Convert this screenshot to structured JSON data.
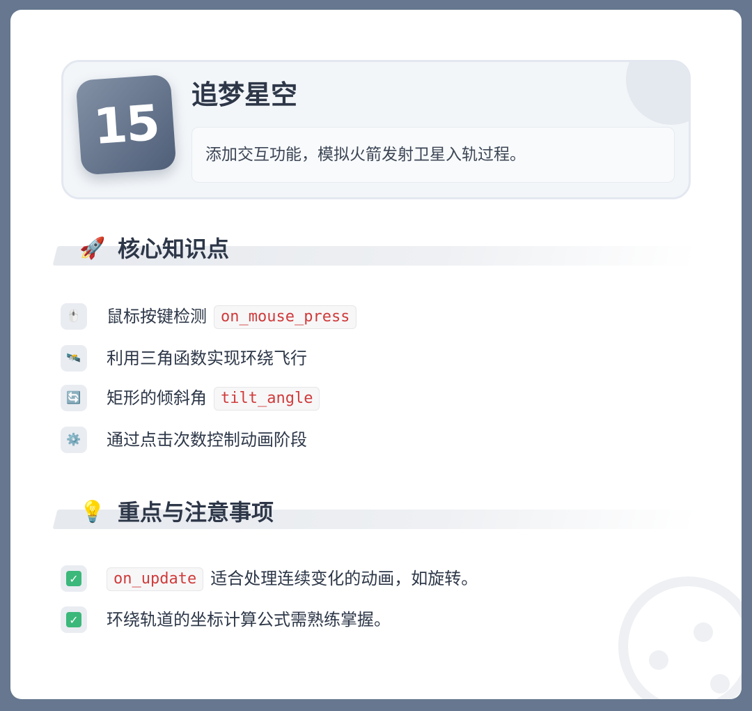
{
  "lesson": {
    "number": "15",
    "title": "追梦星空",
    "description": "添加交互功能，模拟火箭发射卫星入轨过程。"
  },
  "sections": [
    {
      "icon": "rocket-icon",
      "icon_glyph": "🚀",
      "title": "核心知识点",
      "items": [
        {
          "icon": "mouse-icon",
          "icon_glyph": "🖱️",
          "text": "鼠标按键检测",
          "code": "on_mouse_press"
        },
        {
          "icon": "satellite-icon",
          "icon_glyph": "🛰️",
          "text": "利用三角函数实现环绕飞行"
        },
        {
          "icon": "rotate-icon",
          "icon_glyph": "🔄",
          "text": "矩形的倾斜角",
          "code": "tilt_angle"
        },
        {
          "icon": "gear-icon",
          "icon_glyph": "⚙️",
          "text": "通过点击次数控制动画阶段"
        }
      ]
    },
    {
      "icon": "lightbulb-icon",
      "icon_glyph": "💡",
      "title": "重点与注意事项",
      "items": [
        {
          "icon": "check-icon",
          "icon_glyph": "✓",
          "code": "on_update",
          "text": "适合处理连续变化的动画，如旋转。"
        },
        {
          "icon": "check-icon",
          "icon_glyph": "✓",
          "text": "环绕轨道的坐标计算公式需熟练掌握。"
        }
      ]
    }
  ]
}
